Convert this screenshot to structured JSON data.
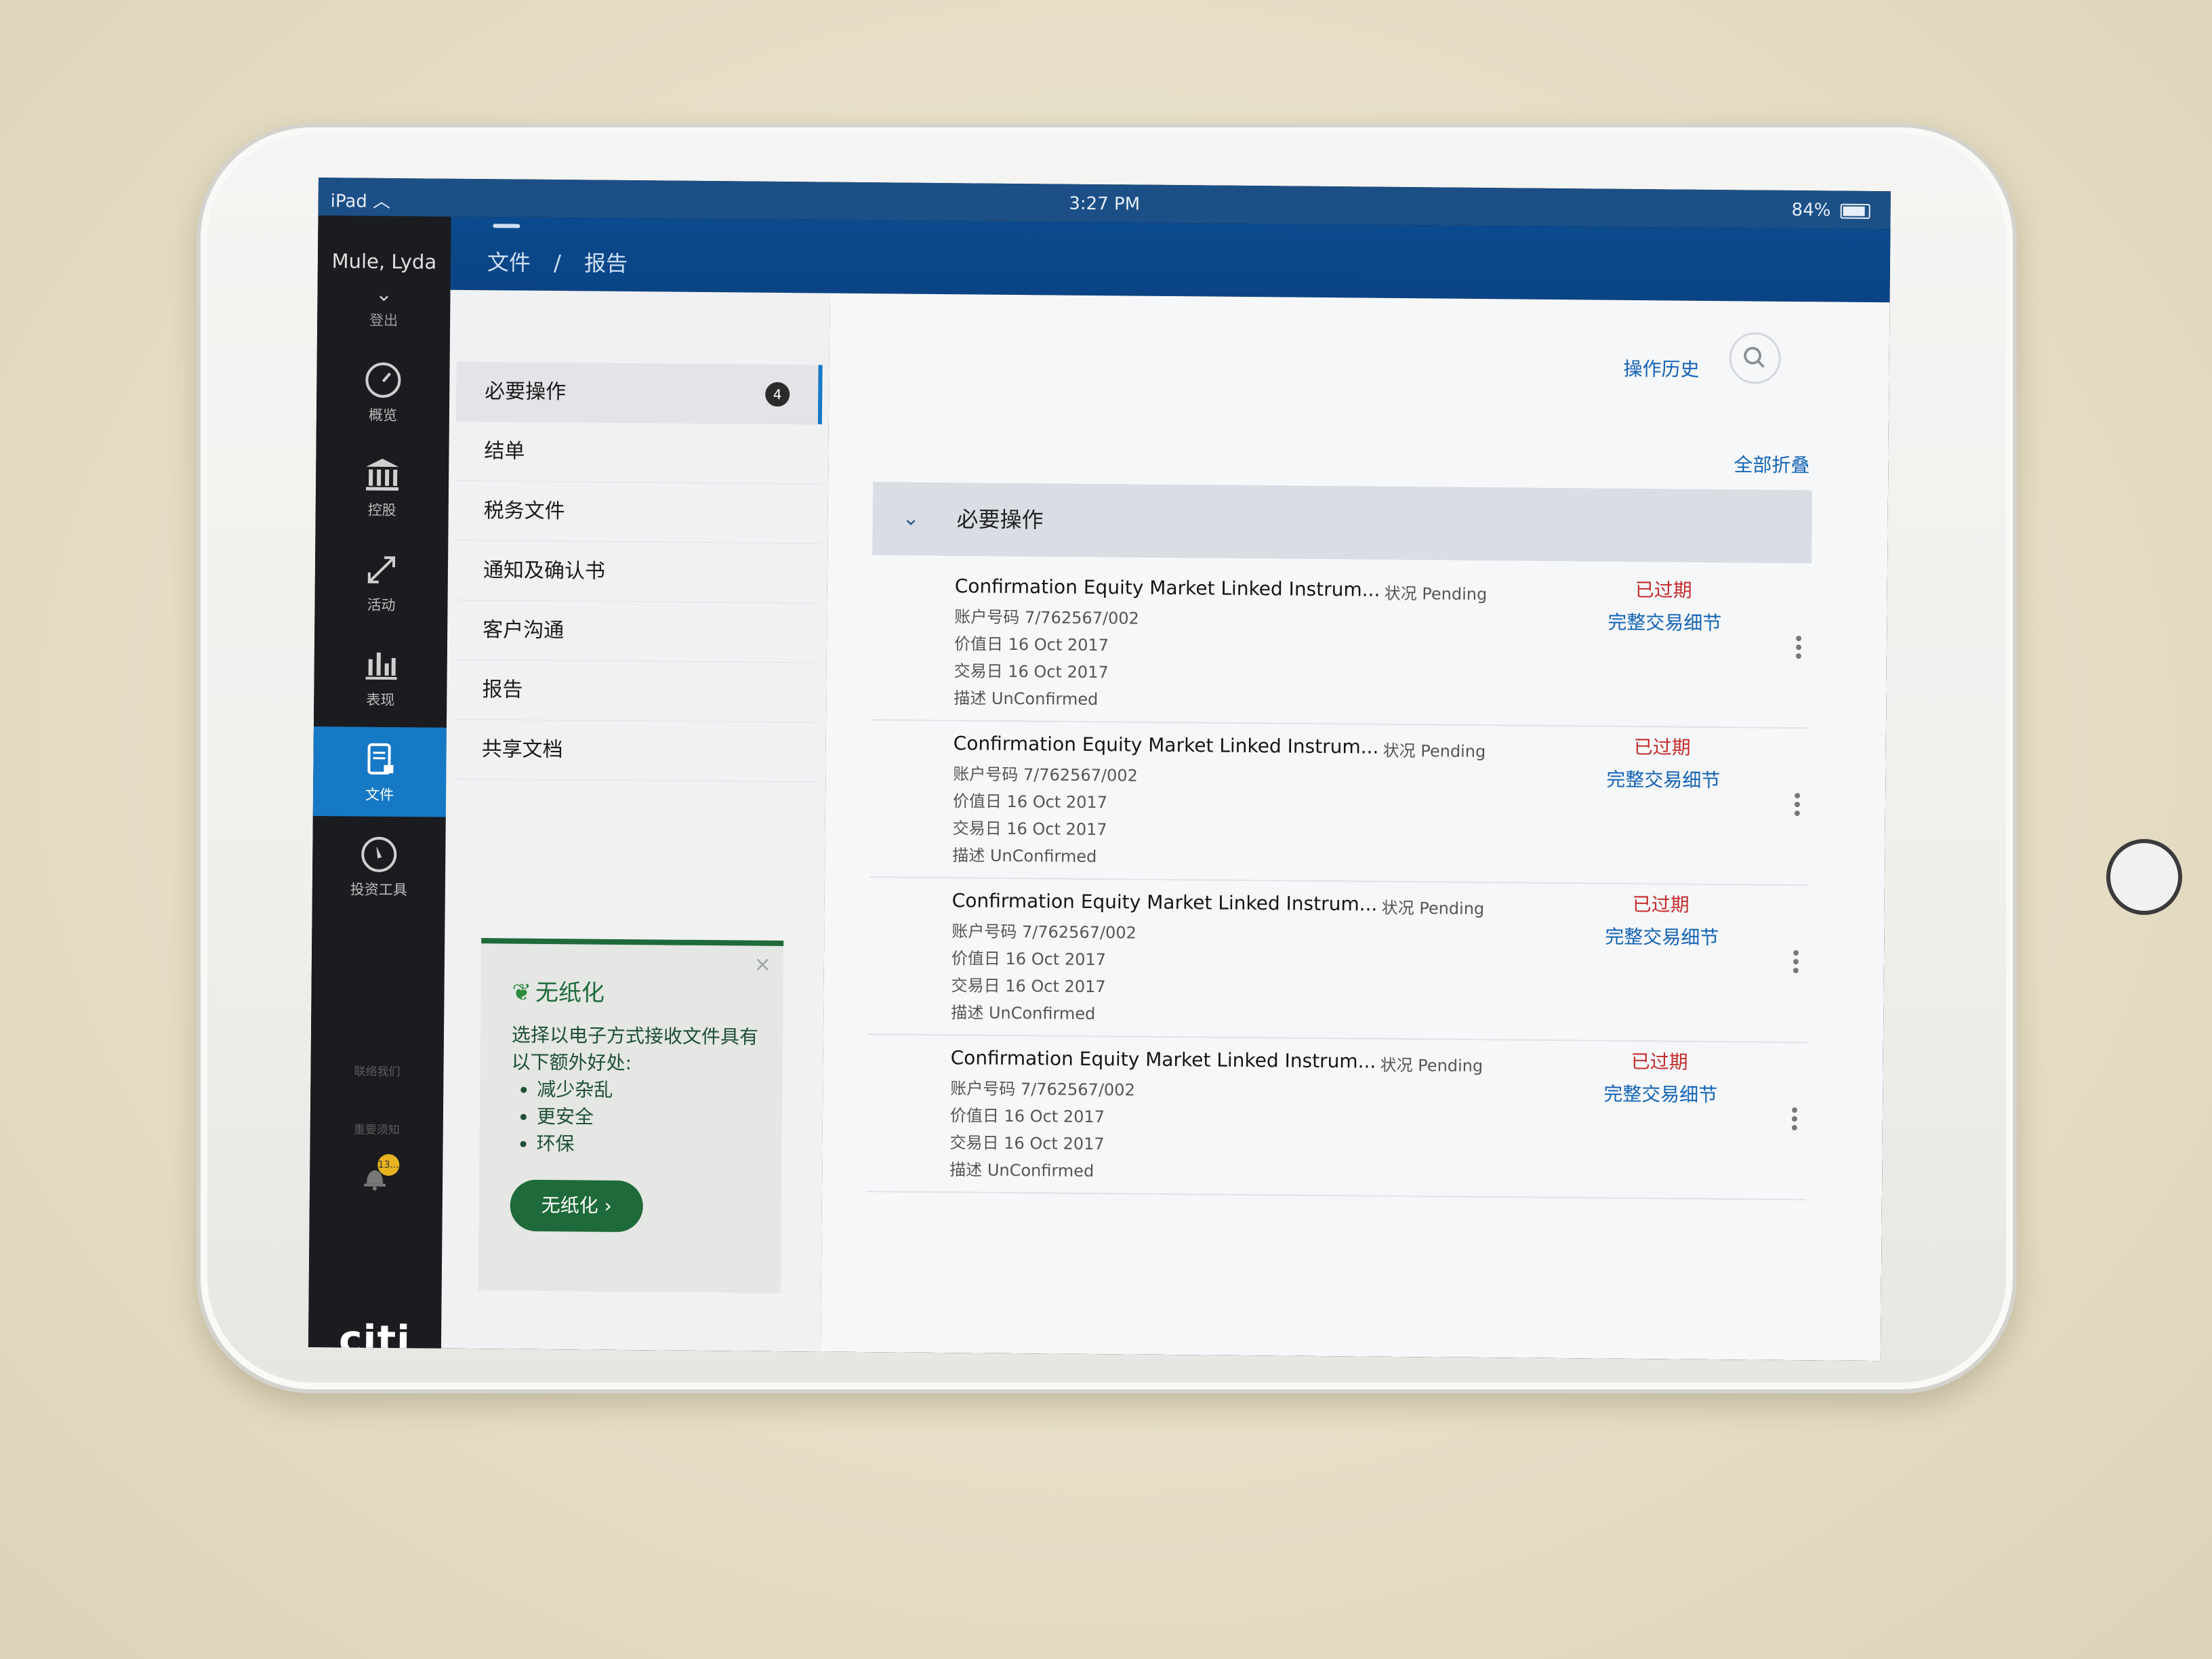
{
  "statusbar": {
    "device": "iPad",
    "time": "3:27 PM",
    "battery": "84%"
  },
  "header": {
    "breadcrumb": [
      "文件",
      "/",
      "报告"
    ]
  },
  "nav": {
    "user": "Mule, Lyda",
    "logout": "登出",
    "items": [
      {
        "label": "概览",
        "icon": "gauge-icon"
      },
      {
        "label": "控股",
        "icon": "bank-icon"
      },
      {
        "label": "活动",
        "icon": "arrows-icon"
      },
      {
        "label": "表现",
        "icon": "bar-chart-icon"
      },
      {
        "label": "文件",
        "icon": "document-lock-icon",
        "active": true
      },
      {
        "label": "投资工具",
        "icon": "compass-icon"
      }
    ],
    "contact": "联络我们",
    "notice": "重要须知",
    "bell_badge": "13...",
    "logo": "citi"
  },
  "categories": [
    {
      "label": "必要操作",
      "badge": "4",
      "active": true
    },
    {
      "label": "结单"
    },
    {
      "label": "税务文件"
    },
    {
      "label": "通知及确认书"
    },
    {
      "label": "客户沟通"
    },
    {
      "label": "报告"
    },
    {
      "label": "共享文档"
    }
  ],
  "promo": {
    "title": "无纸化",
    "desc": "选择以电子方式接收文件具有以下额外好处:",
    "benefits": [
      "减少杂乱",
      "更安全",
      "环保"
    ],
    "button": "无纸化",
    "close": "×"
  },
  "content": {
    "history": "操作历史",
    "collapse_all": "全部折叠",
    "section_title": "必要操作",
    "rows": [
      {
        "title": "Confirmation Equity Market Linked Instrum...",
        "account": "账户号码 7/762567/002",
        "value_date": "价值日 16 Oct 2017",
        "trade_date": "交易日 16 Oct 2017",
        "desc": "描述 UnConfirmed",
        "status": "状况 Pending",
        "expired": "已过期",
        "detail": "完整交易细节"
      },
      {
        "title": "Confirmation Equity Market Linked Instrum...",
        "account": "账户号码 7/762567/002",
        "value_date": "价值日 16 Oct 2017",
        "trade_date": "交易日 16 Oct 2017",
        "desc": "描述 UnConfirmed",
        "status": "状况 Pending",
        "expired": "已过期",
        "detail": "完整交易细节"
      },
      {
        "title": "Confirmation Equity Market Linked Instrum...",
        "account": "账户号码 7/762567/002",
        "value_date": "价值日 16 Oct 2017",
        "trade_date": "交易日 16 Oct 2017",
        "desc": "描述 UnConfirmed",
        "status": "状况 Pending",
        "expired": "已过期",
        "detail": "完整交易细节"
      },
      {
        "title": "Confirmation Equity Market Linked Instrum...",
        "account": "账户号码 7/762567/002",
        "value_date": "价值日 16 Oct 2017",
        "trade_date": "交易日 16 Oct 2017",
        "desc": "描述 UnConfirmed",
        "status": "状况 Pending",
        "expired": "已过期",
        "detail": "完整交易细节"
      }
    ]
  },
  "colors": {
    "accent": "#1679c6",
    "header": "#0b4a8d",
    "expired": "#c52c2c",
    "link": "#1363b6",
    "promo": "#1f6a3a"
  }
}
